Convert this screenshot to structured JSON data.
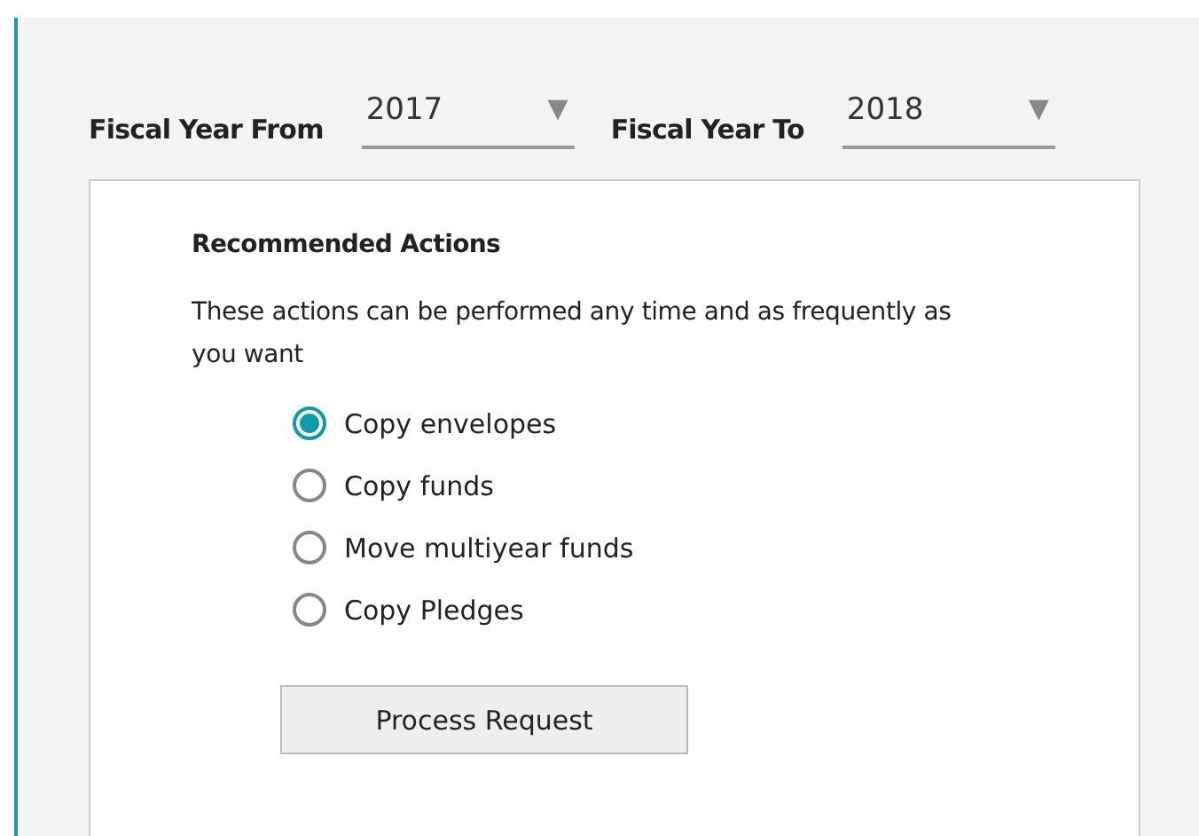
{
  "filters": [
    {
      "label": "Fiscal Year From",
      "value": "2017",
      "arrow": "▼"
    },
    {
      "label": "Fiscal Year To",
      "value": "2018",
      "arrow": "▼"
    }
  ],
  "card": {
    "title": "Recommended Actions",
    "description": "These actions can be performed any time and as frequently as you want",
    "options": [
      {
        "label": "Copy envelopes",
        "selected": true
      },
      {
        "label": "Copy funds",
        "selected": false
      },
      {
        "label": "Move multiyear funds",
        "selected": false
      },
      {
        "label": "Copy Pledges",
        "selected": false
      }
    ],
    "button": "Process Request"
  }
}
